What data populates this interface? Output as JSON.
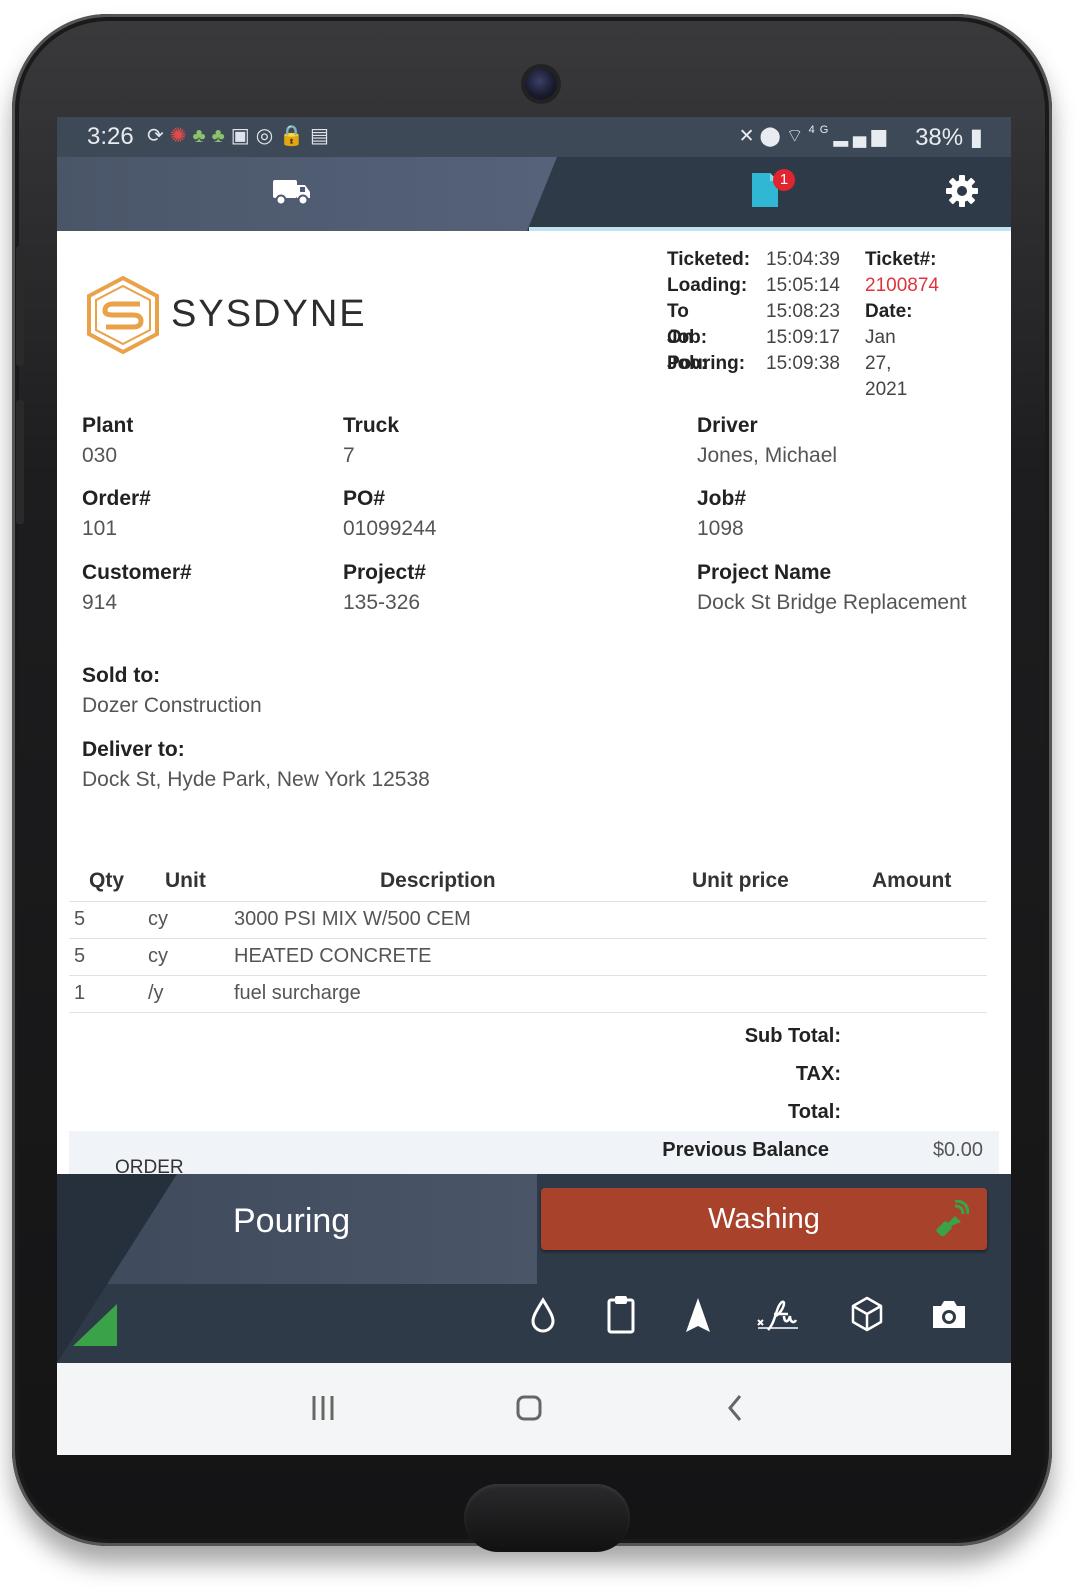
{
  "status_bar": {
    "time": "3:26",
    "battery": "38%",
    "network": "4G"
  },
  "top_bar": {
    "tabs": [
      "truck-tab",
      "ticket-tab"
    ],
    "ticket_badge": "1",
    "active_tab": "ticket-tab"
  },
  "brand": {
    "name": "SYSDYNE",
    "accent_color": "#e9a24a"
  },
  "times": {
    "ticketed_label": "Ticketed:",
    "ticketed": "15:04:39",
    "loading_label": "Loading:",
    "loading": "15:05:14",
    "to_job_label": "To Job:",
    "to_job": "15:08:23",
    "on_job_label": "On Job:",
    "on_job": "15:09:17",
    "pouring_label": "Pouring:",
    "pouring": "15:09:38"
  },
  "ticket": {
    "number_label": "Ticket#:",
    "number": "2100874",
    "date_label": "Date:",
    "date": "Jan 27, 2021"
  },
  "fields": {
    "plant_label": "Plant",
    "plant": "030",
    "truck_label": "Truck",
    "truck": "7",
    "driver_label": "Driver",
    "driver": "Jones, Michael",
    "order_label": "Order#",
    "order": "101",
    "po_label": "PO#",
    "po": "01099244",
    "job_label": "Job#",
    "job": "1098",
    "customer_label": "Customer#",
    "customer": "914",
    "project_label": "Project#",
    "project": "135-326",
    "project_name_label": "Project Name",
    "project_name": "Dock St Bridge Replacement",
    "sold_to_label": "Sold to:",
    "sold_to": "Dozer Construction",
    "deliver_to_label": "Deliver to:",
    "deliver_to": "Dock St, Hyde Park, New York 12538"
  },
  "items": {
    "headers": {
      "qty": "Qty",
      "unit": "Unit",
      "description": "Description",
      "unit_price": "Unit price",
      "amount": "Amount"
    },
    "rows": [
      {
        "qty": "5",
        "unit": "cy",
        "description": "3000 PSI MIX W/500 CEM"
      },
      {
        "qty": "5",
        "unit": "cy",
        "description": "HEATED CONCRETE"
      },
      {
        "qty": "1",
        "unit": "/y",
        "description": "fuel surcharge"
      }
    ]
  },
  "totals": {
    "sub_total_label": "Sub Total:",
    "tax_label": "TAX:",
    "total_label": "Total:",
    "previous_balance_label": "Previous Balance",
    "previous_balance": "$0.00",
    "order_label": "ORDER"
  },
  "actions": {
    "current_status": "Pouring",
    "next_status": "Washing",
    "next_status_color": "#a8422a",
    "tools": [
      "water-drop-icon",
      "clipboard-icon",
      "navigation-arrow-icon",
      "signature-icon",
      "cube-icon",
      "camera-icon"
    ]
  },
  "android_nav": [
    "recents-button",
    "home-button",
    "back-button"
  ]
}
